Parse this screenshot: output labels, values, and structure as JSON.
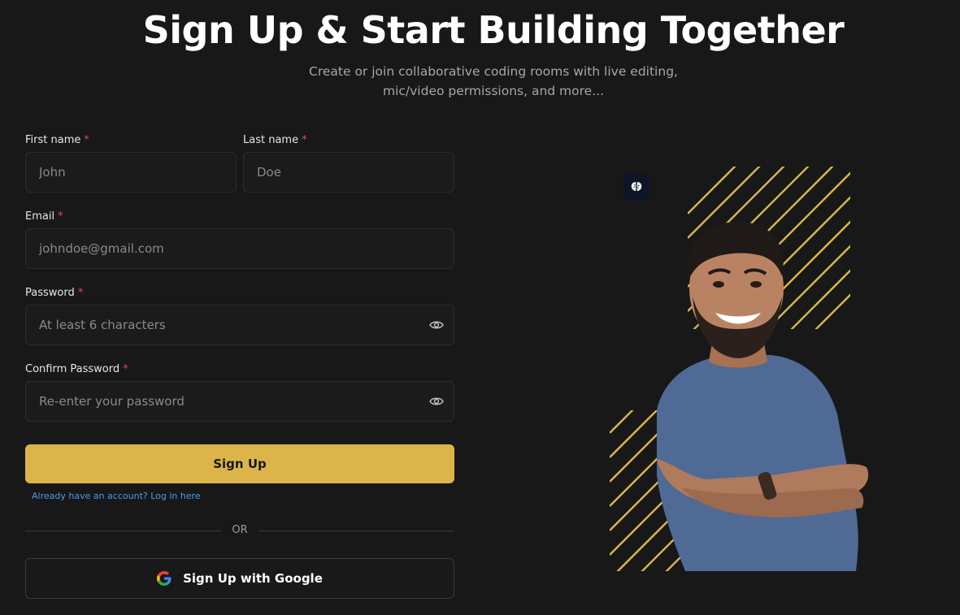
{
  "header": {
    "title": "Sign Up & Start Building Together",
    "subtitle": "Create or join collaborative coding rooms with live editing, mic/video permissions, and more..."
  },
  "form": {
    "first_name": {
      "label": "First name",
      "placeholder": "John",
      "required": "*"
    },
    "last_name": {
      "label": "Last name",
      "placeholder": "Doe",
      "required": "*"
    },
    "email": {
      "label": "Email",
      "placeholder": "johndoe@gmail.com",
      "required": "*"
    },
    "password": {
      "label": "Password",
      "placeholder": "At least 6 characters",
      "required": "*",
      "toggle_icon": "eye-icon"
    },
    "confirm_password": {
      "label": "Confirm Password",
      "placeholder": "Re-enter your password",
      "required": "*",
      "toggle_icon": "eye-icon"
    },
    "submit_label": "Sign Up",
    "login_link": "Already have an account? Log in here",
    "divider_text": "OR",
    "google_label": "Sign Up with Google"
  },
  "hero": {
    "badge_icon": "brain-icon",
    "stripe_color": "#d8b84c",
    "shirt_color": "#4f6a95"
  },
  "colors": {
    "accent": "#dcb54a",
    "link": "#4c9be8",
    "required": "#e5484d",
    "background": "#181818"
  }
}
